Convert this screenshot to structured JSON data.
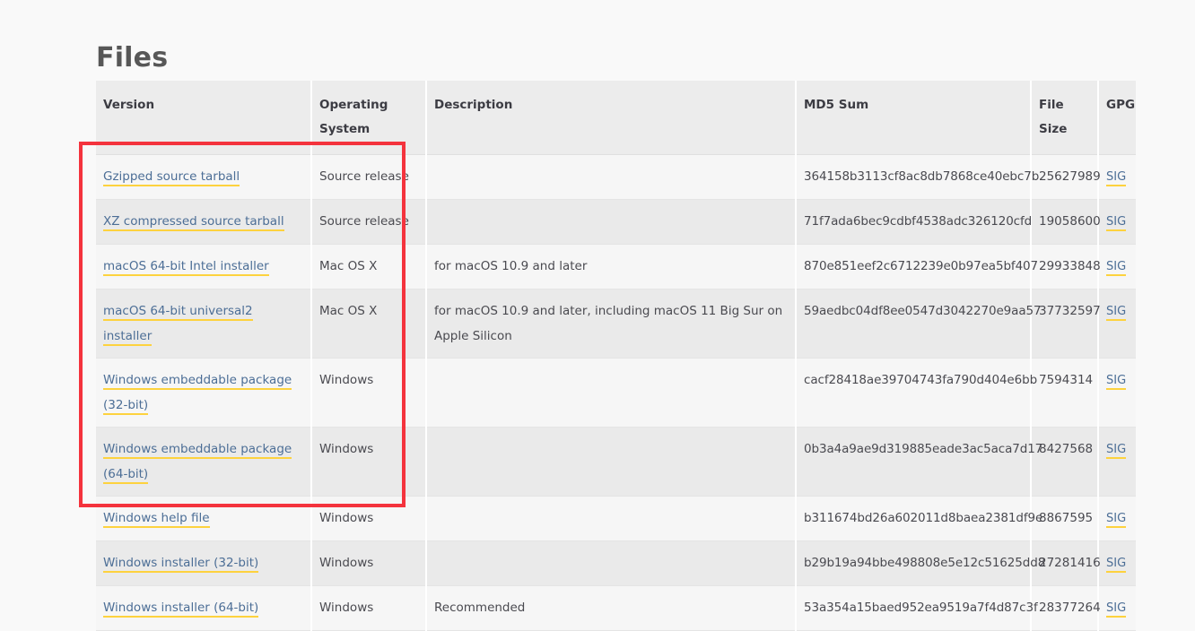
{
  "page": {
    "title": "Files",
    "background_color": "#f9f9f9"
  },
  "annotation": {
    "shape": "rectangle",
    "color": "#f4333d",
    "target": "version-column-links"
  },
  "table": {
    "headers": {
      "version": "Version",
      "operating_system": "Operating System",
      "description": "Description",
      "md5_sum": "MD5 Sum",
      "file_size": "File Size",
      "gpg": "GPG"
    },
    "rows": [
      {
        "version": "Gzipped source tarball",
        "os": "Source release",
        "description": "",
        "md5": "364158b3113cf8ac8db7868ce40ebc7b",
        "size": "25627989",
        "gpg": "SIG"
      },
      {
        "version": "XZ compressed source tarball",
        "os": "Source release",
        "description": "",
        "md5": "71f7ada6bec9cdbf4538adc326120cfd",
        "size": "19058600",
        "gpg": "SIG"
      },
      {
        "version": "macOS 64-bit Intel installer",
        "os": "Mac OS X",
        "description": "for macOS 10.9 and later",
        "md5": "870e851eef2c6712239e0b97ea5bf407",
        "size": "29933848",
        "gpg": "SIG"
      },
      {
        "version": "macOS 64-bit universal2 installer",
        "os": "Mac OS X",
        "description": "for macOS 10.9 and later, including macOS 11 Big Sur on Apple Silicon",
        "md5": "59aedbc04df8ee0547d3042270e9aa57",
        "size": "37732597",
        "gpg": "SIG"
      },
      {
        "version": "Windows embeddable package (32-bit)",
        "os": "Windows",
        "description": "",
        "md5": "cacf28418ae39704743fa790d404e6bb",
        "size": "7594314",
        "gpg": "SIG"
      },
      {
        "version": "Windows embeddable package (64-bit)",
        "os": "Windows",
        "description": "",
        "md5": "0b3a4a9ae9d319885eade3ac5aca7d17",
        "size": "8427568",
        "gpg": "SIG"
      },
      {
        "version": "Windows help file",
        "os": "Windows",
        "description": "",
        "md5": "b311674bd26a602011d8baea2381df9e",
        "size": "8867595",
        "gpg": "SIG"
      },
      {
        "version": "Windows installer (32-bit)",
        "os": "Windows",
        "description": "",
        "md5": "b29b19a94bbe498808e5e12c51625dd8",
        "size": "27281416",
        "gpg": "SIG"
      },
      {
        "version": "Windows installer (64-bit)",
        "os": "Windows",
        "description": "Recommended",
        "md5": "53a354a15baed952ea9519a7f4d87c3f",
        "size": "28377264",
        "gpg": "SIG"
      }
    ]
  },
  "colors": {
    "link": "#4c6e96",
    "link_underline": "#fdd23e",
    "header_bg": "#ececec",
    "row_odd_bg": "#f6f6f6",
    "row_even_bg": "#eaeaea",
    "annotation": "#f4333d",
    "title": "#575757"
  }
}
